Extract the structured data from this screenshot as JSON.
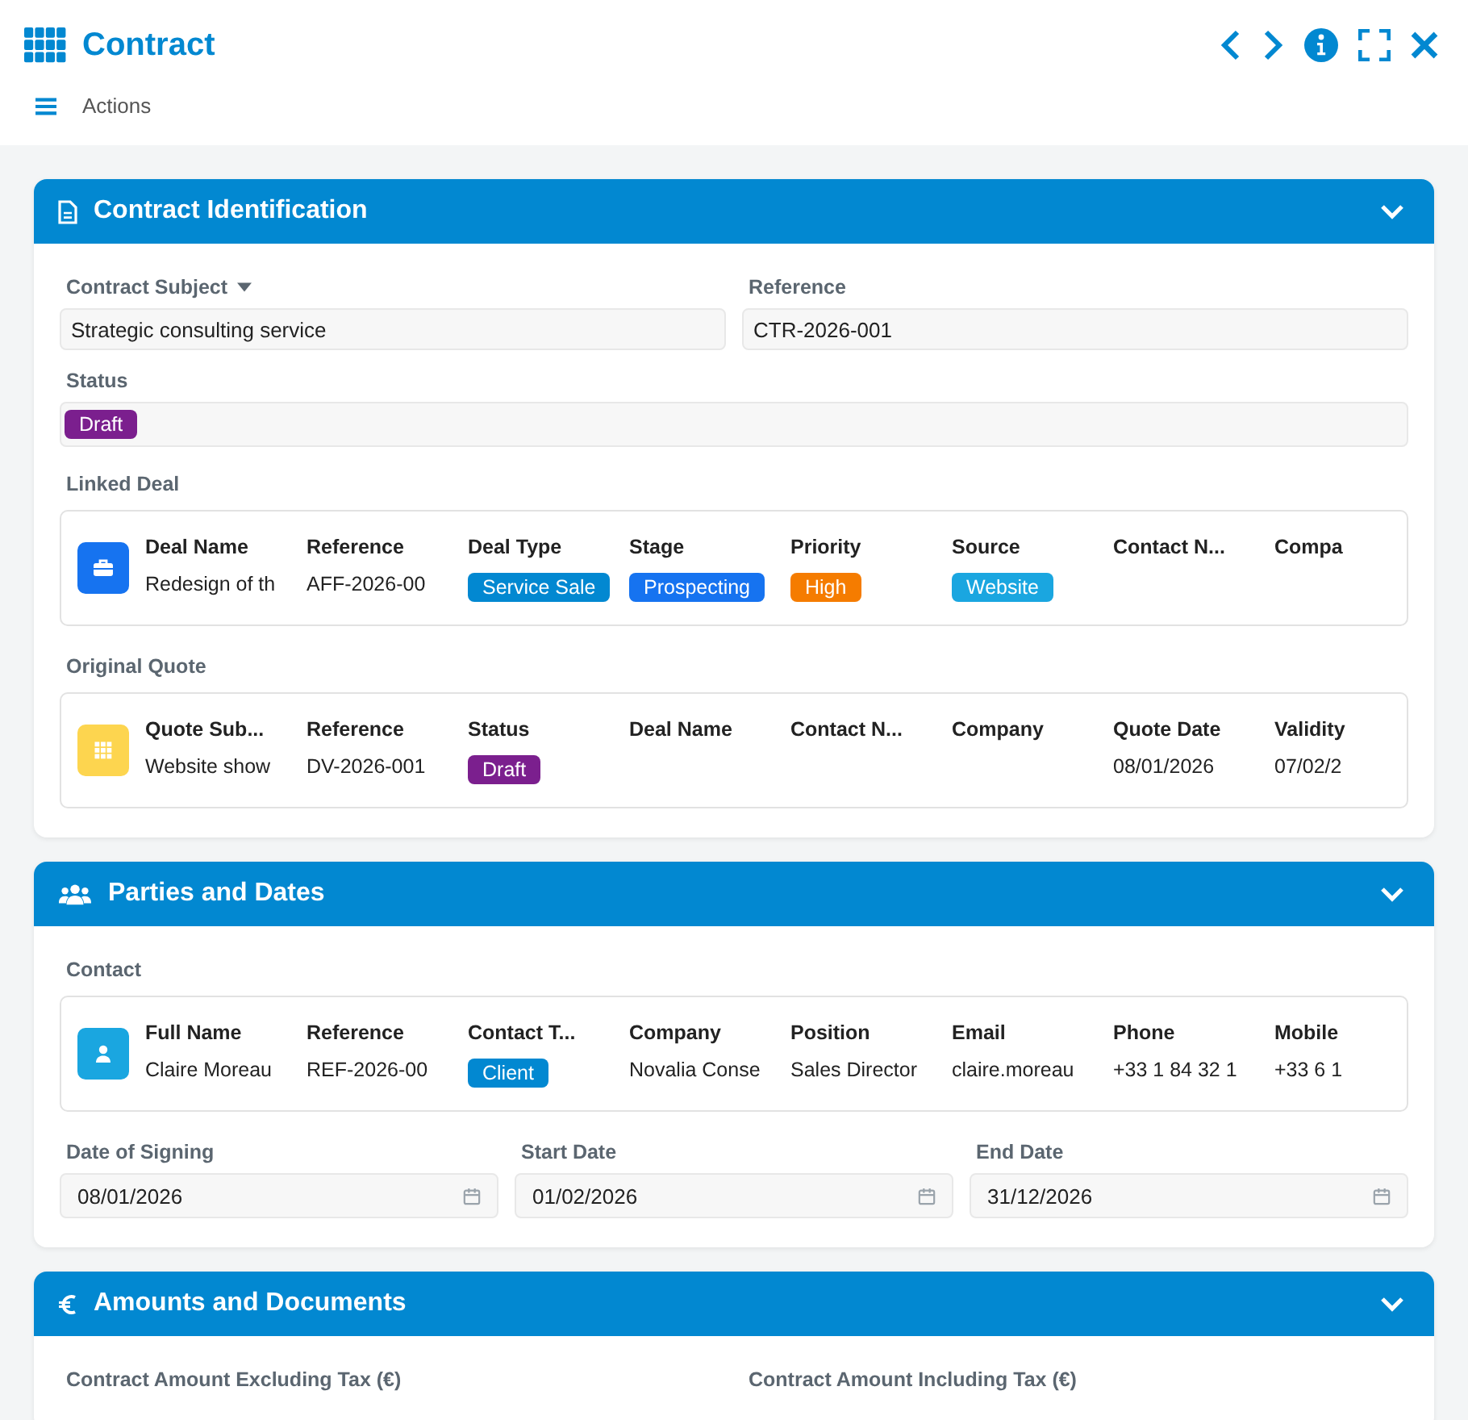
{
  "window": {
    "title": "Contract"
  },
  "toolbar": {
    "actions": "Actions"
  },
  "identification": {
    "title": "Contract Identification",
    "subject": {
      "label": "Contract Subject",
      "value": "Strategic consulting service"
    },
    "reference": {
      "label": "Reference",
      "value": "CTR-2026-001"
    },
    "status": {
      "label": "Status",
      "value": "Draft",
      "color": "#7b1f8e"
    },
    "linked_deal": {
      "label": "Linked Deal",
      "columns": [
        {
          "header": "Deal Name",
          "value": "Redesign of th",
          "kind": "text"
        },
        {
          "header": "Reference",
          "value": "AFF-2026-00",
          "kind": "text"
        },
        {
          "header": "Deal Type",
          "value": "Service Sale",
          "kind": "badge",
          "color": "#0288d1"
        },
        {
          "header": "Stage",
          "value": "Prospecting",
          "kind": "badge",
          "color": "#1673f0"
        },
        {
          "header": "Priority",
          "value": "High",
          "kind": "badge",
          "color": "#f57c00"
        },
        {
          "header": "Source",
          "value": "Website",
          "kind": "badge",
          "color": "#1aa6e0"
        },
        {
          "header": "Contact N..."
        },
        {
          "header": "Compa"
        }
      ]
    },
    "original_quote": {
      "label": "Original Quote",
      "columns": [
        {
          "header": "Quote Sub...",
          "value": "Website show",
          "kind": "text"
        },
        {
          "header": "Reference",
          "value": "DV-2026-001",
          "kind": "text"
        },
        {
          "header": "Status",
          "value": "Draft",
          "kind": "badge",
          "color": "#7b1f8e"
        },
        {
          "header": "Deal Name"
        },
        {
          "header": "Contact N..."
        },
        {
          "header": "Company"
        },
        {
          "header": "Quote Date",
          "value": "08/01/2026",
          "kind": "text"
        },
        {
          "header": "Validity",
          "value": "07/02/2",
          "kind": "text"
        }
      ]
    }
  },
  "parties": {
    "title": "Parties and Dates",
    "contact": {
      "label": "Contact",
      "columns": [
        {
          "header": "Full Name",
          "value": "Claire Moreau",
          "kind": "text"
        },
        {
          "header": "Reference",
          "value": "REF-2026-00",
          "kind": "text"
        },
        {
          "header": "Contact T...",
          "value": "Client",
          "kind": "badge",
          "color": "#0288d1"
        },
        {
          "header": "Company",
          "value": "Novalia Conse",
          "kind": "text"
        },
        {
          "header": "Position",
          "value": "Sales Director",
          "kind": "text"
        },
        {
          "header": "Email",
          "value": "claire.moreau",
          "kind": "text"
        },
        {
          "header": "Phone",
          "value": "+33 1 84 32 1",
          "kind": "text"
        },
        {
          "header": "Mobile",
          "value": "+33 6 1",
          "kind": "text"
        }
      ]
    },
    "dates": [
      {
        "label": "Date of Signing",
        "value": "08/01/2026"
      },
      {
        "label": "Start Date",
        "value": "01/02/2026"
      },
      {
        "label": "End Date",
        "value": "31/12/2026"
      }
    ]
  },
  "amounts": {
    "title": "Amounts and Documents",
    "fields": [
      {
        "label": "Contract Amount Excluding Tax (€)"
      },
      {
        "label": "Contract Amount Including Tax (€)"
      }
    ]
  }
}
